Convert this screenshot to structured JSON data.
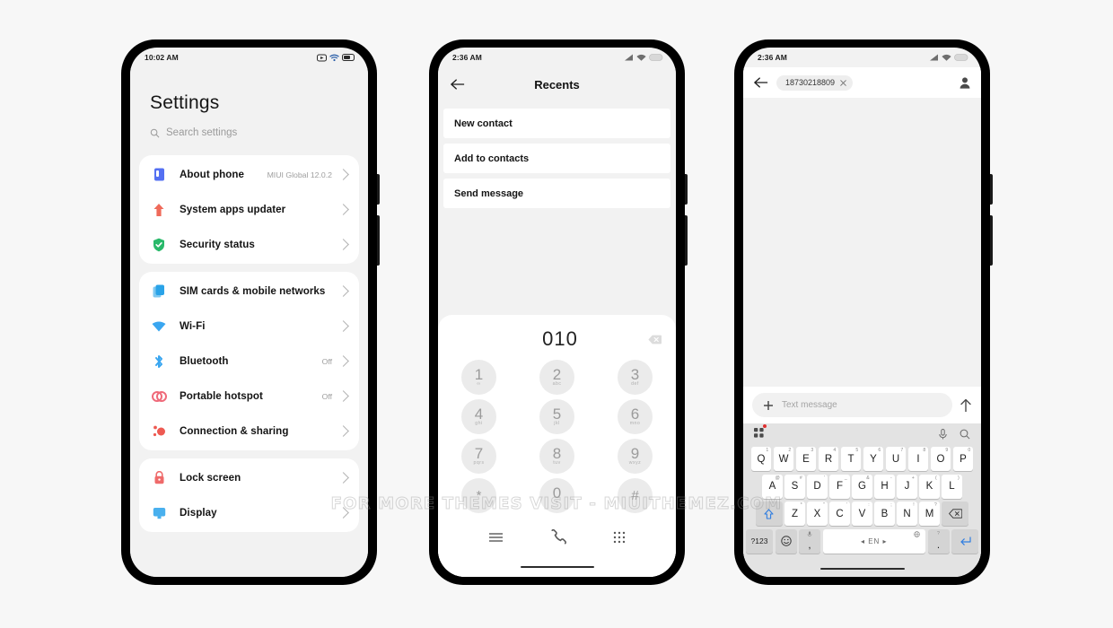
{
  "watermark": "FOR MORE THEMES VISIT - MIUITHEMEZ.COM",
  "phone1": {
    "status": {
      "time": "10:02 AM"
    },
    "title": "Settings",
    "search": {
      "placeholder": "Search settings",
      "icon": "search-icon"
    },
    "groups": [
      {
        "rows": [
          {
            "label": "About phone",
            "value": "MIUI Global 12.0.2",
            "icon": "about-phone-icon",
            "color": "#4a6cf0"
          },
          {
            "label": "System apps updater",
            "value": "",
            "icon": "system-updater-icon",
            "color": "#ef6a5a"
          },
          {
            "label": "Security status",
            "value": "",
            "icon": "security-shield-icon",
            "color": "#29b96a"
          }
        ]
      },
      {
        "rows": [
          {
            "label": "SIM cards & mobile networks",
            "value": "",
            "icon": "sim-card-icon",
            "color": "#2aa3e8"
          },
          {
            "label": "Wi-Fi",
            "value": "",
            "icon": "wifi-icon",
            "color": "#3aa6f0"
          },
          {
            "label": "Bluetooth",
            "value": "Off",
            "icon": "bluetooth-icon",
            "color": "#3aa6f0"
          },
          {
            "label": "Portable hotspot",
            "value": "Off",
            "icon": "hotspot-icon",
            "color": "#ef6a7a"
          },
          {
            "label": "Connection & sharing",
            "value": "",
            "icon": "connection-sharing-icon",
            "color": "#ee5a52"
          }
        ]
      },
      {
        "rows": [
          {
            "label": "Lock screen",
            "value": "",
            "icon": "lock-icon",
            "color": "#ef6a6a"
          },
          {
            "label": "Display",
            "value": "",
            "icon": "display-icon",
            "color": "#49b0ee"
          }
        ]
      }
    ]
  },
  "phone2": {
    "status": {
      "time": "2:36 AM"
    },
    "appbar": {
      "title": "Recents",
      "back_icon": "back-arrow-icon"
    },
    "menu_items": [
      "New contact",
      "Add to contacts",
      "Send message"
    ],
    "dialer": {
      "number": "010",
      "backspace_icon": "backspace-icon",
      "keys": [
        {
          "digit": "1",
          "letters": "∞"
        },
        {
          "digit": "2",
          "letters": "abc"
        },
        {
          "digit": "3",
          "letters": "def"
        },
        {
          "digit": "4",
          "letters": "ghi"
        },
        {
          "digit": "5",
          "letters": "jkl"
        },
        {
          "digit": "6",
          "letters": "mno"
        },
        {
          "digit": "7",
          "letters": "pqrs"
        },
        {
          "digit": "8",
          "letters": "tuv"
        },
        {
          "digit": "9",
          "letters": "wxyz"
        },
        {
          "digit": "*",
          "letters": ""
        },
        {
          "digit": "0",
          "letters": "+"
        },
        {
          "digit": "#",
          "letters": ""
        }
      ],
      "bottom_bar": [
        "menu-icon",
        "call-icon",
        "dialpad-icon"
      ]
    }
  },
  "phone3": {
    "status": {
      "time": "2:36 AM"
    },
    "appbar": {
      "back_icon": "back-arrow-icon",
      "recipient": "18730218809",
      "chip_remove_icon": "close-icon",
      "contact_icon": "contact-person-icon"
    },
    "composer": {
      "add_icon": "plus-icon",
      "placeholder": "Text message",
      "send_icon": "send-arrow-icon"
    },
    "keyboard_toolbar": {
      "left_icon": "apps-grid-icon",
      "badge_color": "#e03030",
      "mic_icon": "microphone-icon",
      "search_icon": "search-icon"
    },
    "keyboard": {
      "row1": [
        {
          "key": "Q",
          "sup": "1"
        },
        {
          "key": "W",
          "sup": "2"
        },
        {
          "key": "E",
          "sup": "3"
        },
        {
          "key": "R",
          "sup": "4"
        },
        {
          "key": "T",
          "sup": "5"
        },
        {
          "key": "Y",
          "sup": "6"
        },
        {
          "key": "U",
          "sup": "7"
        },
        {
          "key": "I",
          "sup": "8"
        },
        {
          "key": "O",
          "sup": "9"
        },
        {
          "key": "P",
          "sup": "0"
        }
      ],
      "row2": [
        {
          "key": "A",
          "sup": "@"
        },
        {
          "key": "S",
          "sup": "#"
        },
        {
          "key": "D",
          "sup": "'"
        },
        {
          "key": "F",
          "sup": "_"
        },
        {
          "key": "G",
          "sup": "&"
        },
        {
          "key": "H",
          "sup": "-"
        },
        {
          "key": "J",
          "sup": "+"
        },
        {
          "key": "K",
          "sup": "("
        },
        {
          "key": "L",
          "sup": ")"
        }
      ],
      "row3": [
        {
          "key": "Z",
          "sup": "*"
        },
        {
          "key": "X",
          "sup": "\""
        },
        {
          "key": "C",
          "sup": "'"
        },
        {
          "key": "V",
          "sup": ":"
        },
        {
          "key": "B",
          "sup": ";"
        },
        {
          "key": "N",
          "sup": "!"
        },
        {
          "key": "M",
          "sup": "?"
        }
      ],
      "shift_icon": "shift-arrow-icon",
      "backspace_icon": "backspace-icon",
      "symbols_key": "?123",
      "emoji_icon": "emoji-icon",
      "comma_key": ",",
      "comma_sup_icon": "microphone-icon",
      "space_label": "◂ EN ▸",
      "space_sup_icon": "globe-icon",
      "period_key": ".",
      "period_sup": "?",
      "enter_icon": "enter-arrow-icon"
    }
  }
}
